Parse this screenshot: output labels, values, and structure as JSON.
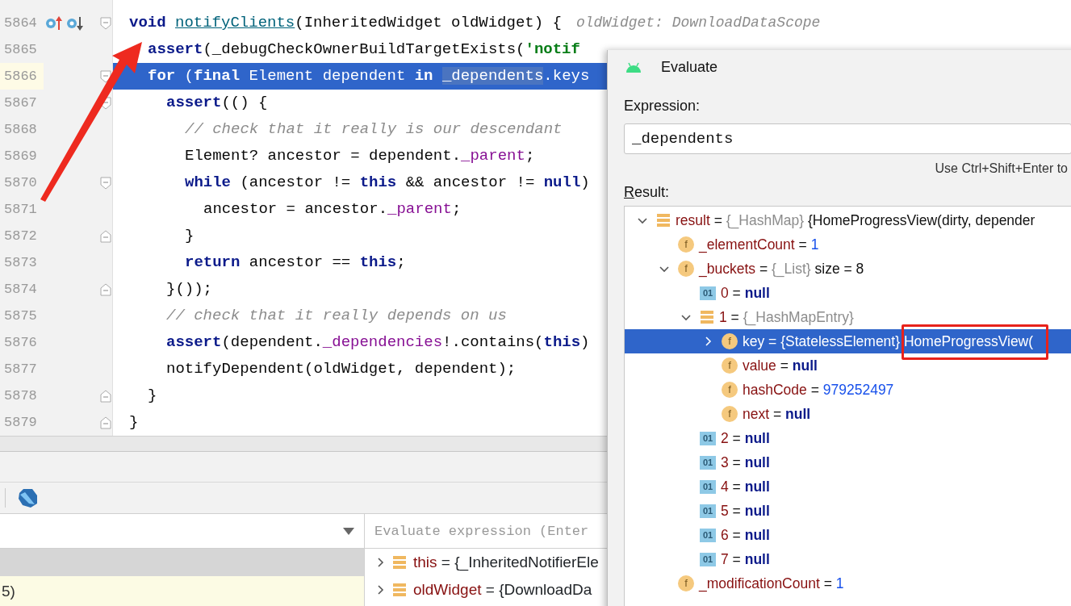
{
  "editor": {
    "lines": [
      {
        "number": "5864",
        "current": false,
        "selected": false,
        "markers": [
          {
            "kind": "overrides"
          },
          {
            "kind": "overridden"
          }
        ],
        "tokens": [
          {
            "kind": "kw",
            "text": "void "
          },
          {
            "kind": "link",
            "text": "notifyClients"
          },
          {
            "kind": "plain",
            "text": "(InheritedWidget oldWidget) {"
          }
        ],
        "hint": "oldWidget: DownloadDataScope",
        "children": [
          {
            "number": "5865",
            "current": false,
            "selected": false,
            "tokens": [
              {
                "kind": "kw",
                "text": "assert"
              },
              {
                "kind": "plain",
                "text": "(_debugCheckOwnerBuildTargetExists("
              },
              {
                "kind": "string",
                "text": "'notif"
              }
            ]
          },
          {
            "number": "5866",
            "current": true,
            "selected": true,
            "tokens": [
              {
                "kind": "kw",
                "text": "for"
              },
              {
                "kind": "plain",
                "text": " ("
              },
              {
                "kind": "kw",
                "text": "final"
              },
              {
                "kind": "plain",
                "text": " Element dependent "
              },
              {
                "kind": "kw",
                "text": "in "
              },
              {
                "kind": "match",
                "text": "_dependents"
              },
              {
                "kind": "plain",
                "text": ".keys"
              }
            ],
            "children": [
              {
                "number": "5867",
                "current": false,
                "selected": false,
                "tokens": [
                  {
                    "kind": "kw",
                    "text": "assert"
                  },
                  {
                    "kind": "plain",
                    "text": "(() {"
                  }
                ],
                "children": [
                  {
                    "number": "5868",
                    "current": false,
                    "selected": false,
                    "tokens": [
                      {
                        "kind": "comment",
                        "text": "// check that it really is our descendant"
                      }
                    ]
                  },
                  {
                    "number": "5869",
                    "current": false,
                    "selected": false,
                    "tokens": [
                      {
                        "kind": "plain",
                        "text": "Element? ancestor = dependent."
                      },
                      {
                        "kind": "field",
                        "text": "_parent"
                      },
                      {
                        "kind": "plain",
                        "text": ";"
                      }
                    ]
                  },
                  {
                    "number": "5870",
                    "current": false,
                    "selected": false,
                    "tokens": [
                      {
                        "kind": "kw",
                        "text": "while"
                      },
                      {
                        "kind": "plain",
                        "text": " (ancestor != "
                      },
                      {
                        "kind": "kw",
                        "text": "this"
                      },
                      {
                        "kind": "plain",
                        "text": " && ancestor != "
                      },
                      {
                        "kind": "kw",
                        "text": "null"
                      },
                      {
                        "kind": "plain",
                        "text": ")"
                      }
                    ],
                    "children": [
                      {
                        "number": "5871",
                        "current": false,
                        "selected": false,
                        "tokens": [
                          {
                            "kind": "plain",
                            "text": "ancestor = ancestor."
                          },
                          {
                            "kind": "field",
                            "text": "_parent"
                          },
                          {
                            "kind": "plain",
                            "text": ";"
                          }
                        ]
                      }
                    ]
                  },
                  {
                    "number": "5872",
                    "current": false,
                    "selected": false,
                    "fold_end": true,
                    "tokens": [
                      {
                        "kind": "plain",
                        "text": "}"
                      }
                    ]
                  },
                  {
                    "number": "5873",
                    "current": false,
                    "selected": false,
                    "tokens": [
                      {
                        "kind": "kw",
                        "text": "return"
                      },
                      {
                        "kind": "plain",
                        "text": " ancestor == "
                      },
                      {
                        "kind": "kw",
                        "text": "this"
                      },
                      {
                        "kind": "plain",
                        "text": ";"
                      }
                    ]
                  }
                ]
              },
              {
                "number": "5874",
                "current": false,
                "selected": false,
                "fold_end": true,
                "tokens": [
                  {
                    "kind": "plain",
                    "text": "}());"
                  }
                ]
              },
              {
                "number": "5875",
                "current": false,
                "selected": false,
                "tokens": [
                  {
                    "kind": "comment",
                    "text": "// check that it really depends on us"
                  }
                ]
              },
              {
                "number": "5876",
                "current": false,
                "selected": false,
                "tokens": [
                  {
                    "kind": "kw",
                    "text": "assert"
                  },
                  {
                    "kind": "plain",
                    "text": "(dependent."
                  },
                  {
                    "kind": "field",
                    "text": "_dependencies"
                  },
                  {
                    "kind": "plain",
                    "text": "!.contains("
                  },
                  {
                    "kind": "kw",
                    "text": "this"
                  },
                  {
                    "kind": "plain",
                    "text": ")"
                  }
                ]
              },
              {
                "number": "5877",
                "current": false,
                "selected": false,
                "tokens": [
                  {
                    "kind": "plain",
                    "text": "notifyDependent(oldWidget, dependent);"
                  }
                ]
              }
            ]
          },
          {
            "number": "5878",
            "current": false,
            "selected": false,
            "fold_end": true,
            "tokens": [
              {
                "kind": "plain",
                "text": "}"
              }
            ]
          }
        ]
      },
      {
        "number": "5879",
        "current": false,
        "selected": false,
        "fold_end": true,
        "tokens": [
          {
            "kind": "plain",
            "text": "}"
          }
        ]
      }
    ]
  },
  "debugger": {
    "frames": [
      {
        "text": "5)",
        "current": true
      }
    ],
    "evaluate_placeholder": "Evaluate expression (Enter",
    "variables": [
      {
        "name": "this",
        "separator": "=",
        "type": "{_InheritedNotifierEle",
        "expanded": false
      },
      {
        "name": "oldWidget",
        "separator": "=",
        "type": "{DownloadDa",
        "expanded": false
      }
    ]
  },
  "dialog": {
    "title": "Evaluate",
    "expression_label": "Expression:",
    "expression": "_dependents",
    "hint": "Use Ctrl+Shift+Enter to",
    "result_label": "Result:",
    "result": [
      {
        "kind": "object",
        "name": "result",
        "separator": "=",
        "type": "{_HashMap}",
        "value": "{HomeProgressView(dirty, depender",
        "expanded": true,
        "selected": false,
        "children": [
          {
            "kind": "field",
            "badge": "f",
            "name": "_elementCount",
            "separator": "=",
            "value": "1",
            "numeric": true,
            "selected": false
          },
          {
            "kind": "field",
            "badge": "f",
            "name": "_buckets",
            "separator": "=",
            "type": "{_List}",
            "value": "size = 8",
            "expanded": true,
            "selected": false,
            "children": [
              {
                "kind": "index",
                "badge": "01",
                "name": "0",
                "separator": "=",
                "value": "null",
                "literal": true,
                "selected": false
              },
              {
                "kind": "object",
                "name": "1",
                "separator": "=",
                "type": "{_HashMapEntry}",
                "expanded": true,
                "selected": false,
                "children": [
                  {
                    "kind": "field",
                    "badge": "f",
                    "name": "key",
                    "separator": "=",
                    "type": "{StatelessElement}",
                    "value": "HomeProgressView(",
                    "expanded": false,
                    "selected": true,
                    "annotated": true
                  },
                  {
                    "kind": "field",
                    "badge": "f",
                    "name": "value",
                    "separator": "=",
                    "value": "null",
                    "literal": true,
                    "selected": false
                  },
                  {
                    "kind": "field",
                    "badge": "f",
                    "name": "hashCode",
                    "separator": "=",
                    "value": "979252497",
                    "numeric": true,
                    "selected": false
                  },
                  {
                    "kind": "field",
                    "badge": "f",
                    "name": "next",
                    "separator": "=",
                    "value": "null",
                    "literal": true,
                    "selected": false
                  }
                ]
              },
              {
                "kind": "index",
                "badge": "01",
                "name": "2",
                "separator": "=",
                "value": "null",
                "literal": true,
                "selected": false
              },
              {
                "kind": "index",
                "badge": "01",
                "name": "3",
                "separator": "=",
                "value": "null",
                "literal": true,
                "selected": false
              },
              {
                "kind": "index",
                "badge": "01",
                "name": "4",
                "separator": "=",
                "value": "null",
                "literal": true,
                "selected": false
              },
              {
                "kind": "index",
                "badge": "01",
                "name": "5",
                "separator": "=",
                "value": "null",
                "literal": true,
                "selected": false
              },
              {
                "kind": "index",
                "badge": "01",
                "name": "6",
                "separator": "=",
                "value": "null",
                "literal": true,
                "selected": false
              },
              {
                "kind": "index",
                "badge": "01",
                "name": "7",
                "separator": "=",
                "value": "null",
                "literal": true,
                "selected": false
              }
            ]
          },
          {
            "kind": "field",
            "badge": "f",
            "name": "_modificationCount",
            "separator": "=",
            "value": "1",
            "numeric": true,
            "selected": false
          }
        ]
      }
    ]
  }
}
